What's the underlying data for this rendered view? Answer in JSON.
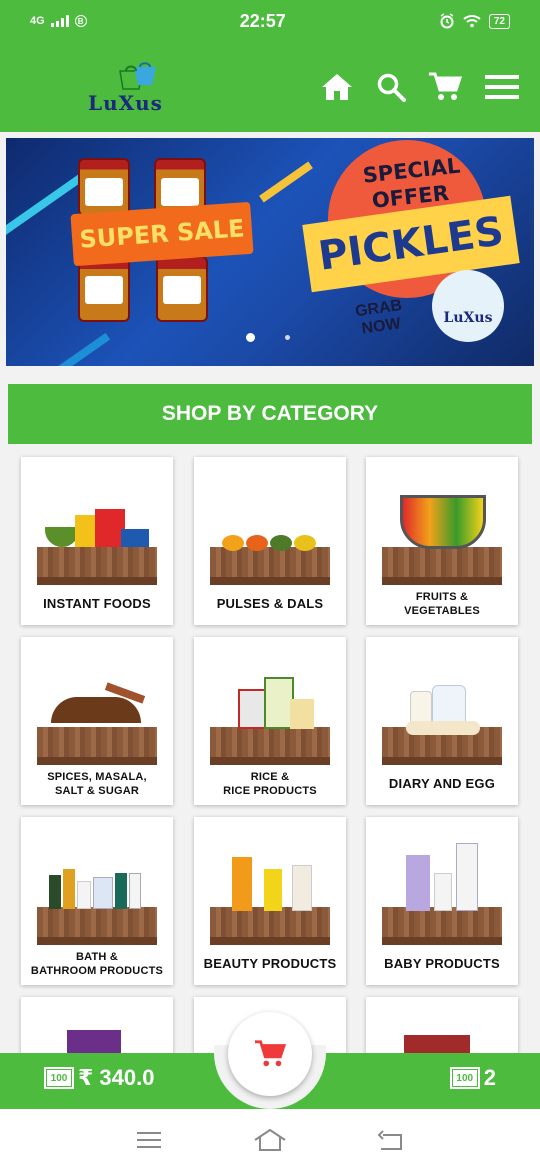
{
  "status_bar": {
    "network": "4G",
    "badge": "B",
    "time": "22:57",
    "battery": "72",
    "icons": [
      "signal-icon",
      "alarm-icon",
      "wifi-icon",
      "battery-icon"
    ]
  },
  "app_bar": {
    "logo_text": "LuXus",
    "icons": [
      "home-icon",
      "search-icon",
      "cart-icon",
      "menu-icon"
    ]
  },
  "banner": {
    "super_sale": "SUPER SALE",
    "special_offer": "SPECIAL OFFER",
    "headline": "PICKLES",
    "cta": "GRAB NOW",
    "logo_text": "LuXus",
    "slide_count": 2,
    "active_slide": 1
  },
  "category_header": "SHOP BY CATEGORY",
  "categories": [
    {
      "line1": "INSTANT FOODS",
      "line2": "",
      "icon": "instant-foods-image"
    },
    {
      "line1": "PULSES & DALS",
      "line2": "",
      "icon": "pulses-image"
    },
    {
      "line1": "FRUITS &",
      "line2": "VEGETABLES",
      "icon": "fruit-basket-image"
    },
    {
      "line1": "SPICES, MASALA,",
      "line2": "SALT & SUGAR",
      "icon": "spices-image"
    },
    {
      "line1": "RICE &",
      "line2": "RICE PRODUCTS",
      "icon": "rice-bags-image"
    },
    {
      "line1": "DIARY AND EGG",
      "line2": "",
      "icon": "dairy-image"
    },
    {
      "line1": "BATH &",
      "line2": "BATHROOM PRODUCTS",
      "icon": "bath-products-image"
    },
    {
      "line1": "BEAUTY PRODUCTS",
      "line2": "",
      "icon": "beauty-products-image"
    },
    {
      "line1": "BABY PRODUCTS",
      "line2": "",
      "icon": "baby-products-image"
    }
  ],
  "cart_bar": {
    "total": "₹ 340.0",
    "item_count": "2",
    "box_label": "100"
  },
  "colors": {
    "brand_green": "#4cbb3e",
    "cart_red": "#f03a3a"
  }
}
